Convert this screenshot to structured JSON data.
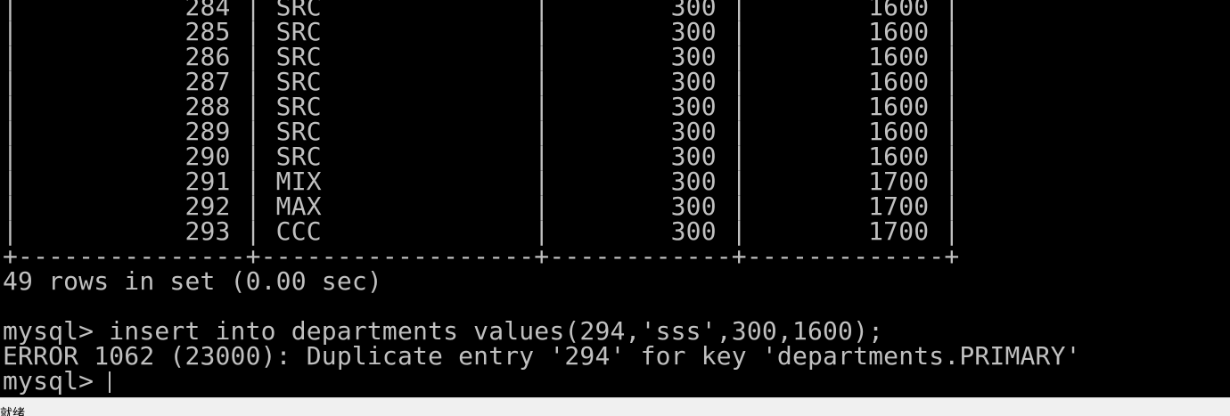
{
  "terminal": {
    "table_rows": [
      "|           284 | SRC              |        300 |        1600 |",
      "|           285 | SRC              |        300 |        1600 |",
      "|           286 | SRC              |        300 |        1600 |",
      "|           287 | SRC              |        300 |        1600 |",
      "|           288 | SRC              |        300 |        1600 |",
      "|           289 | SRC              |        300 |        1600 |",
      "|           290 | SRC              |        300 |        1600 |",
      "|           291 | MIX              |        300 |        1700 |",
      "|           292 | MAX              |        300 |        1700 |",
      "|           293 | CCC              |        300 |        1700 |"
    ],
    "table_border": "+---------------+------------------+------------+-------------+",
    "rows_summary": "49 rows in set (0.00 sec)",
    "command_line": "mysql> insert into departments values(294,'sss',300,1600);",
    "error_line": "ERROR 1062 (23000): Duplicate entry '294' for key 'departments.PRIMARY'",
    "prompt": "mysql> "
  },
  "statusbar": {
    "text": "就绪"
  },
  "colors": {
    "background": "#000000",
    "foreground": "#c0c0c0",
    "statusbar": "#f0f0f0"
  }
}
